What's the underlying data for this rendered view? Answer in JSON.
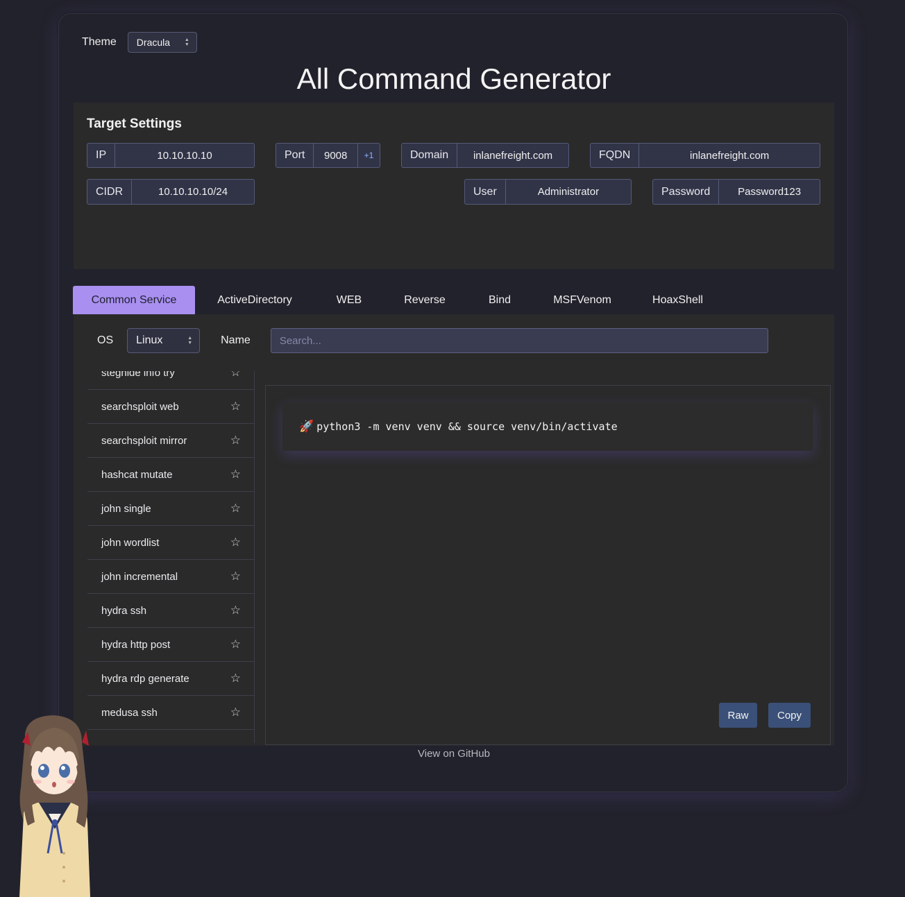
{
  "theme": {
    "label": "Theme",
    "selected": "Dracula"
  },
  "title": "All Command Generator",
  "target_settings": {
    "title": "Target Settings",
    "ip": {
      "label": "IP",
      "value": "10.10.10.10"
    },
    "port": {
      "label": "Port",
      "value": "9008",
      "increment": "+1"
    },
    "domain": {
      "label": "Domain",
      "value": "inlanefreight.com"
    },
    "fqdn": {
      "label": "FQDN",
      "value": "inlanefreight.com"
    },
    "cidr": {
      "label": "CIDR",
      "value": "10.10.10.10/24"
    },
    "user": {
      "label": "User",
      "value": "Administrator"
    },
    "password": {
      "label": "Password",
      "value": "Password123"
    }
  },
  "tabs": [
    "Common Service",
    "ActiveDirectory",
    "WEB",
    "Reverse",
    "Bind",
    "MSFVenom",
    "HoaxShell"
  ],
  "active_tab": "Common Service",
  "filters": {
    "os_label": "OS",
    "os_selected": "Linux",
    "name_label": "Name",
    "search_placeholder": "Search..."
  },
  "commands": [
    "steghide info try",
    "searchsploit web",
    "searchsploit mirror",
    "hashcat mutate",
    "john single",
    "john wordlist",
    "john incremental",
    "hydra ssh",
    "hydra http post",
    "hydra rdp generate",
    "medusa ssh"
  ],
  "command_output": {
    "icon": "rocket-icon",
    "text": "python3 -m venv venv && source venv/bin/activate"
  },
  "buttons": {
    "raw": "Raw",
    "copy": "Copy"
  },
  "footer": {
    "github": "View on GitHub"
  },
  "colors": {
    "background": "#22222c",
    "panel": "#2a2a2a",
    "active_tab": "#a88ff0",
    "button": "#3a5078"
  }
}
